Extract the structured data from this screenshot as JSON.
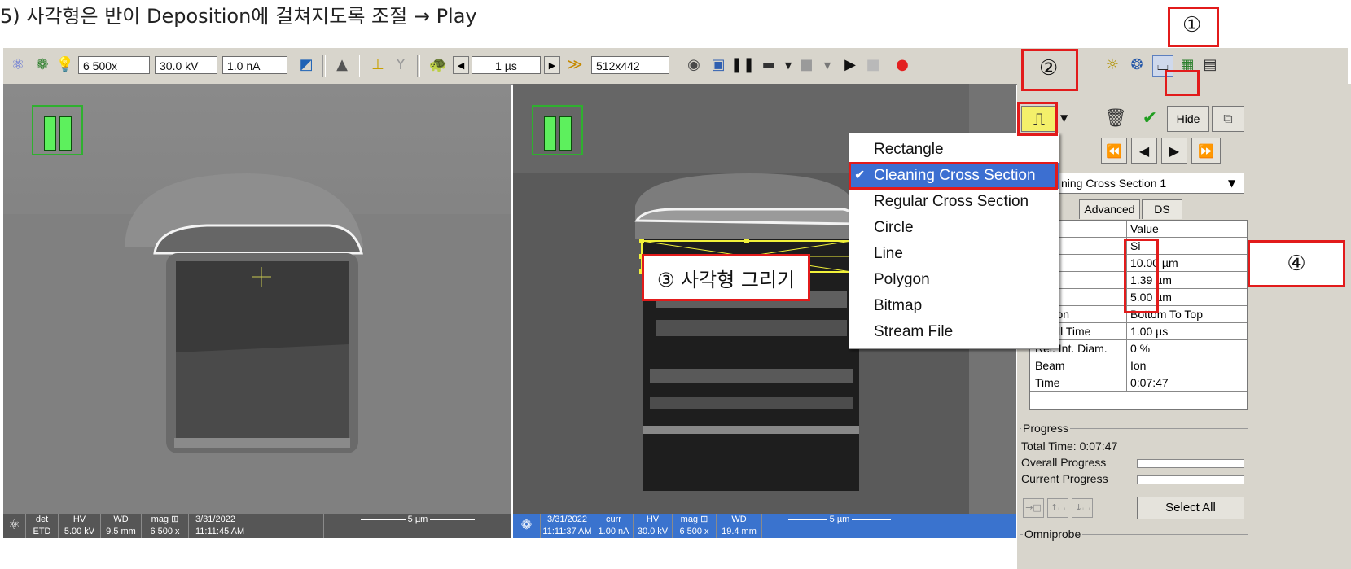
{
  "title": "5)   사각형은 반이 Deposition에 걸쳐지도록 조절 → Play",
  "toolbar": {
    "magnification": "6 500x",
    "hv": "30.0 kV",
    "current": "1.0 nA",
    "dwell": "1 µs",
    "resolution": "512x442"
  },
  "electron_image": {
    "databar": {
      "det_label": "det",
      "det_value": "ETD",
      "hv_label": "HV",
      "hv_value": "5.00 kV",
      "wd_label": "WD",
      "wd_value": "9.5 mm",
      "mag_label": "mag ⊞",
      "mag_value": "6 500 x",
      "date": "3/31/2022",
      "time": "11:11:45 AM",
      "scale": "5 µm"
    }
  },
  "ion_image": {
    "databar": {
      "date": "3/31/2022",
      "time": "11:11:37 AM",
      "curr_label": "curr",
      "curr_value": "1.00 nA",
      "hv_label": "HV",
      "hv_value": "30.0 kV",
      "mag_label": "mag ⊞",
      "mag_value": "6 500 x",
      "wd_label": "WD",
      "wd_value": "19.4 mm",
      "scale": "5 µm"
    }
  },
  "dropdown_menu": {
    "items": [
      {
        "label": "Rectangle",
        "selected": false
      },
      {
        "label": "Cleaning Cross Section",
        "selected": true
      },
      {
        "label": "Regular Cross Section",
        "selected": false
      },
      {
        "label": "Circle",
        "selected": false
      },
      {
        "label": "Line",
        "selected": false
      },
      {
        "label": "Polygon",
        "selected": false
      },
      {
        "label": "Bitmap",
        "selected": false
      },
      {
        "label": "Stream File",
        "selected": false
      }
    ]
  },
  "pattern_panel": {
    "hide_label": "Hide",
    "pattern_select_value": "ning Cross Section 1",
    "tabs": [
      "Advanced",
      "DS"
    ],
    "value_header": "Value",
    "rows": [
      {
        "name": "tion",
        "value": "Si"
      },
      {
        "name": "",
        "value": "10.00 µm"
      },
      {
        "name": "",
        "value": "1.39 µm"
      },
      {
        "name": "",
        "value": "5.00 µm"
      },
      {
        "name": "rection",
        "value": "Bottom To Top"
      },
      {
        "name": "Dwell Time",
        "value": "1.00 µs"
      },
      {
        "name": "Rel. Int. Diam.",
        "value": "0 %"
      },
      {
        "name": "Beam",
        "value": "Ion"
      },
      {
        "name": "Time",
        "value": "0:07:47"
      }
    ],
    "progress": {
      "group_label": "Progress",
      "total_time": "Total Time:  0:07:47",
      "overall": "Overall Progress",
      "current": "Current Progress",
      "overall_fraction": 0,
      "current_fraction": 0
    },
    "select_all": "Select All",
    "omniprobe": "Omniprobe"
  },
  "annotations": {
    "n1": "①",
    "n2": "②",
    "n3": "③ 사각형 그리기",
    "n4": "④"
  },
  "colors": {
    "annotation_red": "#e21b1b",
    "highlight_blue": "#3c6fd1",
    "pattern_yellow": "#f2f23a",
    "pause_green": "#5df05d",
    "ion_databar_blue": "#3a73ce"
  }
}
